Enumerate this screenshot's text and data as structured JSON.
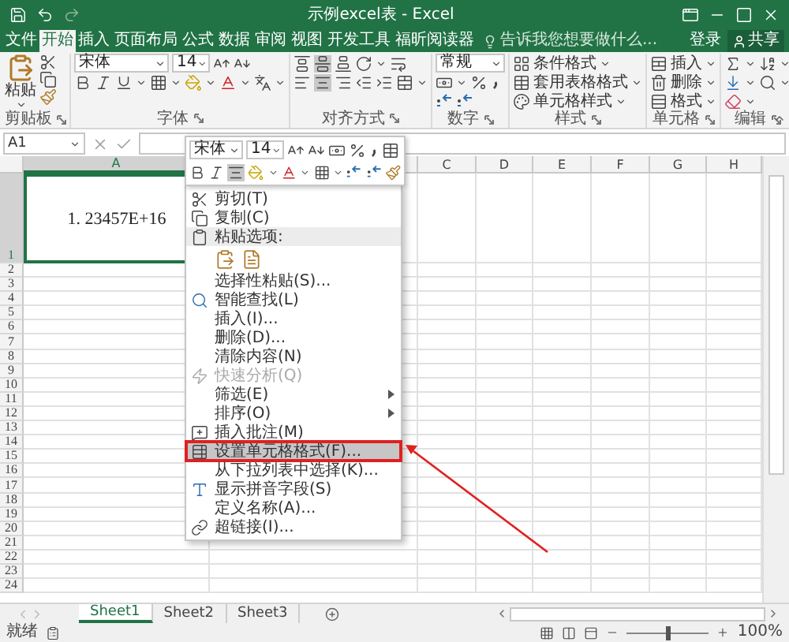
{
  "window": {
    "title": "示例excel表 - Excel"
  },
  "tabs": [
    {
      "label": "文件",
      "selected": false
    },
    {
      "label": "开始",
      "selected": true
    },
    {
      "label": "插入",
      "selected": false
    },
    {
      "label": "页面布局",
      "selected": false
    },
    {
      "label": "公式",
      "selected": false
    },
    {
      "label": "数据",
      "selected": false
    },
    {
      "label": "审阅",
      "selected": false
    },
    {
      "label": "视图",
      "selected": false
    },
    {
      "label": "开发工具",
      "selected": false
    },
    {
      "label": "福昕阅读器",
      "selected": false
    }
  ],
  "tell_me": {
    "placeholder": "告诉我您想要做什么..."
  },
  "account": {
    "sign_in": "登录",
    "share": "共享"
  },
  "ribbon": {
    "clipboard": {
      "label": "剪贴板",
      "paste": "粘贴"
    },
    "font": {
      "label": "字体",
      "font": "宋体",
      "size": "14"
    },
    "alignment": {
      "label": "对齐方式",
      "middle_selected": true,
      "center_selected": true
    },
    "number": {
      "label": "数字",
      "format": "常规"
    },
    "styles": {
      "label": "样式",
      "buttons": [
        "条件格式",
        "套用表格格式",
        "单元格样式"
      ]
    },
    "cells": {
      "label": "单元格",
      "buttons": [
        "插入",
        "删除",
        "格式"
      ]
    },
    "editing": {
      "label": "编辑"
    }
  },
  "formula_bar": {
    "name_box": "A1"
  },
  "mini_toolbar": {
    "font": "宋体",
    "size": "14",
    "center_selected": true
  },
  "sheet": {
    "columns": [
      {
        "label": "A",
        "selected": true
      },
      {
        "label": "C",
        "selected": false
      },
      {
        "label": "D",
        "selected": false
      },
      {
        "label": "E",
        "selected": false
      },
      {
        "label": "F",
        "selected": false
      },
      {
        "label": "G",
        "selected": false
      },
      {
        "label": "H",
        "selected": false
      }
    ],
    "rows": [
      {
        "label": "1",
        "selected": true
      },
      {
        "label": "2",
        "selected": false
      },
      {
        "label": "3",
        "selected": false
      },
      {
        "label": "4",
        "selected": false
      },
      {
        "label": "5",
        "selected": false
      },
      {
        "label": "6",
        "selected": false
      },
      {
        "label": "7",
        "selected": false
      },
      {
        "label": "8",
        "selected": false
      },
      {
        "label": "9",
        "selected": false
      },
      {
        "label": "10",
        "selected": false
      },
      {
        "label": "11",
        "selected": false
      },
      {
        "label": "12",
        "selected": false
      },
      {
        "label": "13",
        "selected": false
      },
      {
        "label": "14",
        "selected": false
      },
      {
        "label": "15",
        "selected": false
      },
      {
        "label": "16",
        "selected": false
      },
      {
        "label": "17",
        "selected": false
      },
      {
        "label": "18",
        "selected": false
      },
      {
        "label": "19",
        "selected": false
      },
      {
        "label": "20",
        "selected": false
      },
      {
        "label": "21",
        "selected": false
      },
      {
        "label": "22",
        "selected": false
      },
      {
        "label": "23",
        "selected": false
      },
      {
        "label": "24",
        "selected": false
      }
    ],
    "a1": {
      "value": "1. 23457E+16",
      "selected": true
    }
  },
  "context_menu": {
    "items": [
      {
        "kind": "cut",
        "label": "剪切(T)",
        "selected": false,
        "disabled": false
      },
      {
        "kind": "copy",
        "label": "复制(C)",
        "selected": false,
        "disabled": false
      },
      {
        "kind": "paste-header",
        "label": "粘贴选项:",
        "selected": false,
        "disabled": false
      },
      {
        "kind": "paste-icons"
      },
      {
        "kind": "plain",
        "label": "选择性粘贴(S)...",
        "selected": false,
        "disabled": false
      },
      {
        "kind": "lookup",
        "label": "智能查找(L)",
        "selected": false,
        "disabled": false
      },
      {
        "kind": "plain",
        "label": "插入(I)...",
        "selected": false,
        "disabled": false
      },
      {
        "kind": "plain",
        "label": "删除(D)...",
        "selected": false,
        "disabled": false
      },
      {
        "kind": "plain",
        "label": "清除内容(N)",
        "selected": false,
        "disabled": false
      },
      {
        "kind": "analysis",
        "label": "快速分析(Q)",
        "selected": false,
        "disabled": true
      },
      {
        "kind": "submenu",
        "label": "筛选(E)",
        "selected": false,
        "disabled": false
      },
      {
        "kind": "submenu",
        "label": "排序(O)",
        "selected": false,
        "disabled": false
      },
      {
        "kind": "comment",
        "label": "插入批注(M)",
        "selected": false,
        "disabled": false
      },
      {
        "kind": "format",
        "label": "设置单元格格式(F)...",
        "selected": true,
        "disabled": false,
        "marked": true
      },
      {
        "kind": "plain",
        "label": "从下拉列表中选择(K)...",
        "selected": false,
        "disabled": false
      },
      {
        "kind": "pinyin",
        "label": "显示拼音字段(S)",
        "selected": false,
        "disabled": false
      },
      {
        "kind": "plain",
        "label": "定义名称(A)...",
        "selected": false,
        "disabled": false
      },
      {
        "kind": "link",
        "label": "超链接(I)...",
        "selected": false,
        "disabled": false
      }
    ]
  },
  "annotation": {
    "arrow": true
  },
  "sheet_tabs": [
    {
      "label": "Sheet1",
      "selected": true
    },
    {
      "label": "Sheet2",
      "selected": false
    },
    {
      "label": "Sheet3",
      "selected": false
    }
  ],
  "status_bar": {
    "status": "就绪",
    "zoom": {
      "level": 0.5,
      "reading": "100%"
    }
  }
}
